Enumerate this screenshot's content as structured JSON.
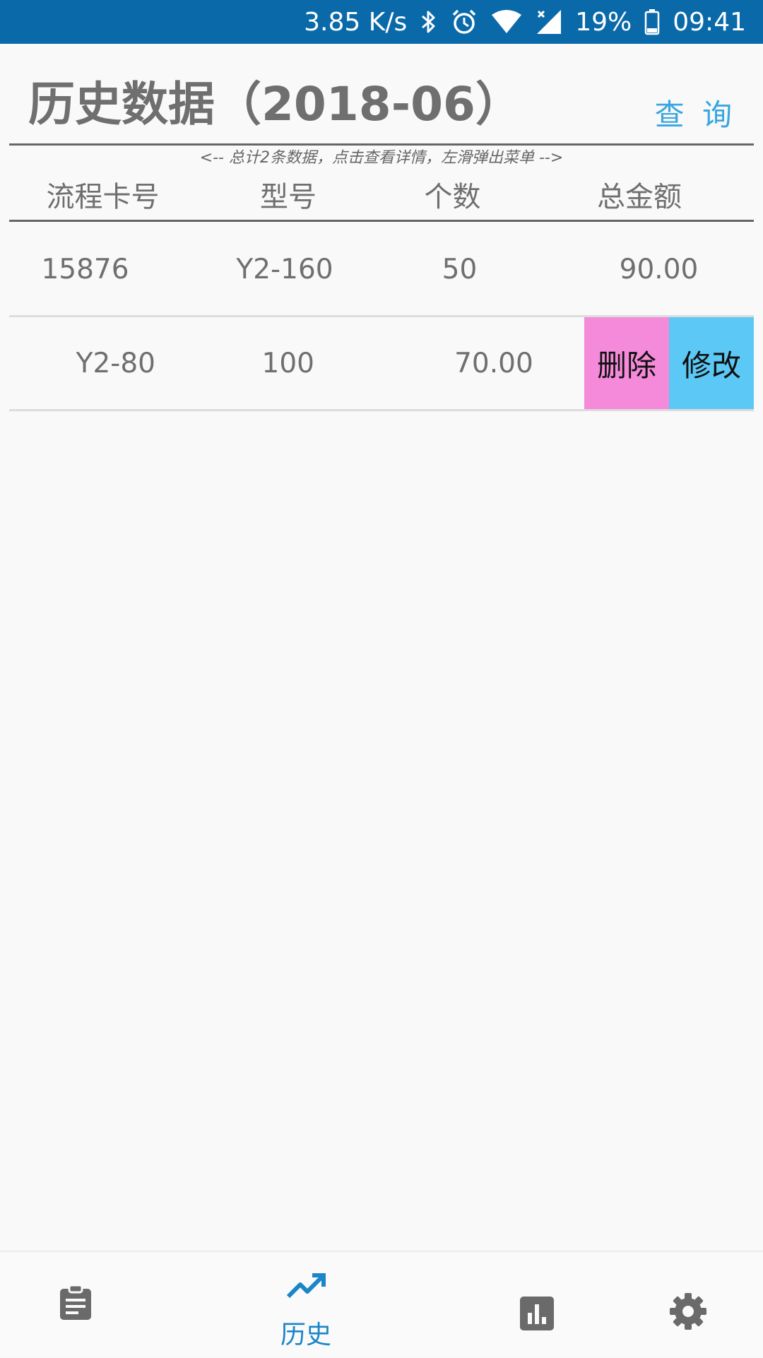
{
  "status_bar": {
    "net_speed": "3.85 K/s",
    "battery": "19%",
    "time": "09:41",
    "icons": [
      "bluetooth-icon",
      "alarm-icon",
      "wifi-icon",
      "signal-icon",
      "battery-icon"
    ]
  },
  "header": {
    "title": "历史数据（2018-06）",
    "query_label": "查 询",
    "hint": "<-- 总计2条数据，点击查看详情，左滑弹出菜单 -->"
  },
  "table": {
    "columns": [
      "流程卡号",
      "型号",
      "个数",
      "总金额"
    ],
    "rows": [
      {
        "card_no": "15876",
        "model": "Y2-160",
        "count": "50",
        "amount": "90.00"
      },
      {
        "model": "Y2-80",
        "count": "100",
        "amount": "70.00"
      }
    ],
    "swipe_menu": {
      "delete_label": "删除",
      "edit_label": "修改"
    }
  },
  "bottom_nav": {
    "items": [
      {
        "icon": "clipboard-icon"
      },
      {
        "icon": "trending-up-icon",
        "label": "历史",
        "active": true
      },
      {
        "icon": "bar-chart-icon"
      },
      {
        "icon": "gear-icon"
      }
    ]
  },
  "colors": {
    "status_bar": "#0a6aa9",
    "accent": "#3aa6e0",
    "active_nav": "#1a86c7",
    "delete_bg": "#f48ad9",
    "edit_bg": "#5bc8f5"
  }
}
